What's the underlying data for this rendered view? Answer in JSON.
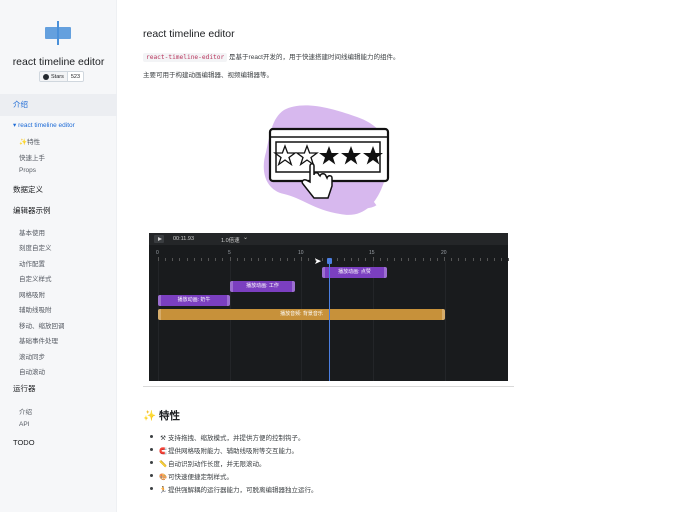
{
  "sidebar": {
    "brand": "react timeline editor",
    "stars_label": "Stars",
    "stars_count": "523",
    "intro_label": "介绍",
    "items_intro": [
      "react timeline editor",
      "✨特性",
      "快速上手",
      "Props"
    ],
    "group_data": "数据定义",
    "group_examples": "编辑器示例",
    "items_examples": [
      "基本使用",
      "刻度自定义",
      "动作配置",
      "自定义样式",
      "网格吸附",
      "辅助线吸附",
      "移动、缩放回调",
      "基础事件处理",
      "滚动同步",
      "自动滚动"
    ],
    "group_runner": "运行器",
    "items_runner": [
      "介绍",
      "API"
    ],
    "group_todo": "TODO"
  },
  "main": {
    "title": "react timeline editor",
    "intro_code": "react-timeline-editor",
    "intro_rest": " 是基于react开发的，用于快速搭建时间线编辑能力的组件。",
    "intro2": "主要可用于构建动画编辑器、视频编辑器等。",
    "editor": {
      "time": "00:11.93",
      "rate": "1.0倍速",
      "ruler_labels": [
        "0",
        "5",
        "10",
        "15",
        "20"
      ],
      "actions": [
        "播放动画: 点赞",
        "播放动画: 工作",
        "播放动画: 奶牛",
        "播放音频: 背景音乐"
      ]
    },
    "features_title": "✨ 特性",
    "features": [
      {
        "emoji": "⚒",
        "text": "支持拖拽、缩放模式，并提供方便的控制钩子。"
      },
      {
        "emoji": "🧲",
        "text": "提供网格吸附能力、辅助线吸附等交互能力。"
      },
      {
        "emoji": "📏",
        "text": "自动识别动作长度，并无限滚动。"
      },
      {
        "emoji": "🎨",
        "text": "可快速便捷定制样式。"
      },
      {
        "emoji": "🏃",
        "text": "提供强解耦的运行器能力，可脱离编辑器独立运行。"
      }
    ]
  },
  "colors": {
    "accent": "#1e6bd6",
    "action": "#7b3fc0",
    "audio": "#c7913a",
    "cursor": "#4c7fe0"
  },
  "icons": [
    "logo-icon",
    "github-icon",
    "play-icon",
    "chevron-down-icon",
    "star-icon",
    "cursor-hand-icon"
  ]
}
